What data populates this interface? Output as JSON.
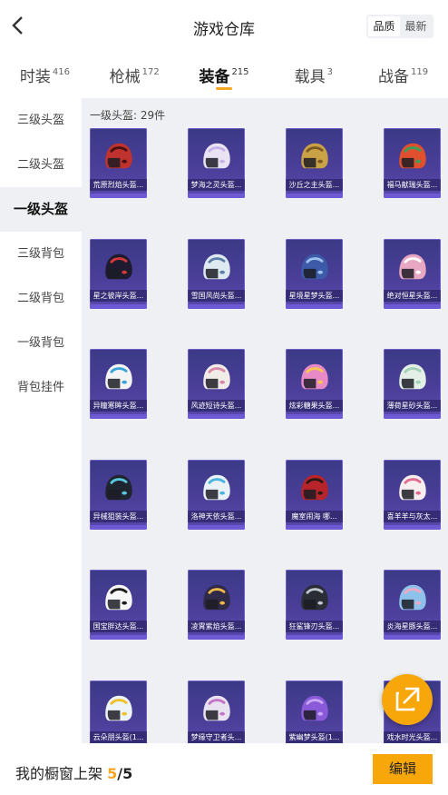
{
  "header": {
    "title": "游戏仓库",
    "sort_options": [
      "品质",
      "最新"
    ],
    "sort_selected": 0
  },
  "tabs": [
    {
      "label": "时装",
      "count": "416"
    },
    {
      "label": "枪械",
      "count": "172"
    },
    {
      "label": "装备",
      "count": "215"
    },
    {
      "label": "载具",
      "count": "3"
    },
    {
      "label": "战备",
      "count": "119"
    }
  ],
  "active_tab": 2,
  "sidebar": {
    "items": [
      "三级头盔",
      "二级头盔",
      "一级头盔",
      "三级背包",
      "二级背包",
      "一级背包",
      "背包挂件"
    ],
    "active": 2
  },
  "content": {
    "count_label": "一级头盔: 29件"
  },
  "items": [
    {
      "name": "荒原烈焰头盔...",
      "color": "#c0322d",
      "accent": "#4a1010"
    },
    {
      "name": "梦海之灵头盔...",
      "color": "#e9e3f3",
      "accent": "#c6b3e5"
    },
    {
      "name": "沙丘之主头盔...",
      "color": "#c9a246",
      "accent": "#7a5a20"
    },
    {
      "name": "福马献瑞头盔...",
      "color": "#e0502e",
      "accent": "#3aa05a"
    },
    {
      "name": "星之彼岸头盔...",
      "color": "#1e1b30",
      "accent": "#d23a3a"
    },
    {
      "name": "雪国风尚头盔...",
      "color": "#dfe9f2",
      "accent": "#5c7fa8"
    },
    {
      "name": "星境星梦头盔...",
      "color": "#3c5aa8",
      "accent": "#9fc0ec"
    },
    {
      "name": "绝对恒星头盔...",
      "color": "#e8a7c3",
      "accent": "#ffffff"
    },
    {
      "name": "异瞳寒眸头盔...",
      "color": "#f4f4f4",
      "accent": "#3aa3d8"
    },
    {
      "name": "风迹短诗头盔...",
      "color": "#f2ece9",
      "accent": "#d48aa8"
    },
    {
      "name": "炫彩糖果头盔...",
      "color": "#e98ac8",
      "accent": "#f5c84c"
    },
    {
      "name": "薄荷星砂头盔...",
      "color": "#e4efe7",
      "accent": "#9ed1b5"
    },
    {
      "name": "异械狙装头盔...",
      "color": "#20242e",
      "accent": "#58c7e0"
    },
    {
      "name": "洛神天依头盔...",
      "color": "#eaf2f8",
      "accent": "#4cb3e0"
    },
    {
      "name": "魔室闹海 哪...",
      "color": "#b7242a",
      "accent": "#2a1812"
    },
    {
      "name": "喜羊羊与灰太...",
      "color": "#f7eef0",
      "accent": "#e06b8e"
    },
    {
      "name": "国宝胖达头盔...",
      "color": "#f7f7f7",
      "accent": "#1c1c1c"
    },
    {
      "name": "凌霄紫焰头盔...",
      "color": "#2e2a48",
      "accent": "#f0b84a"
    },
    {
      "name": "狂鲨锋刃头盔...",
      "color": "#2a2d36",
      "accent": "#bfc6d0"
    },
    {
      "name": "炎海星豚头盔...",
      "color": "#8fc2ea",
      "accent": "#f3a9c4"
    },
    {
      "name": "云朵朋头盔(1...",
      "color": "#eef3f8",
      "accent": "#f0c02a"
    },
    {
      "name": "梦缘守卫者头...",
      "color": "#e9e2f0",
      "accent": "#c274c8"
    },
    {
      "name": "紫幽梦头盔(1...",
      "color": "#8a5ad8",
      "accent": "#c9a8f5"
    },
    {
      "name": "戏水时光头盔...",
      "color": "#9fd8e6",
      "accent": "#f5c44a"
    }
  ],
  "footer": {
    "shelf_label": "我的橱窗上架 ",
    "shelf_current": "5",
    "shelf_total": "/5",
    "edit_label": "编辑"
  },
  "accent_color": "#f7a70a"
}
